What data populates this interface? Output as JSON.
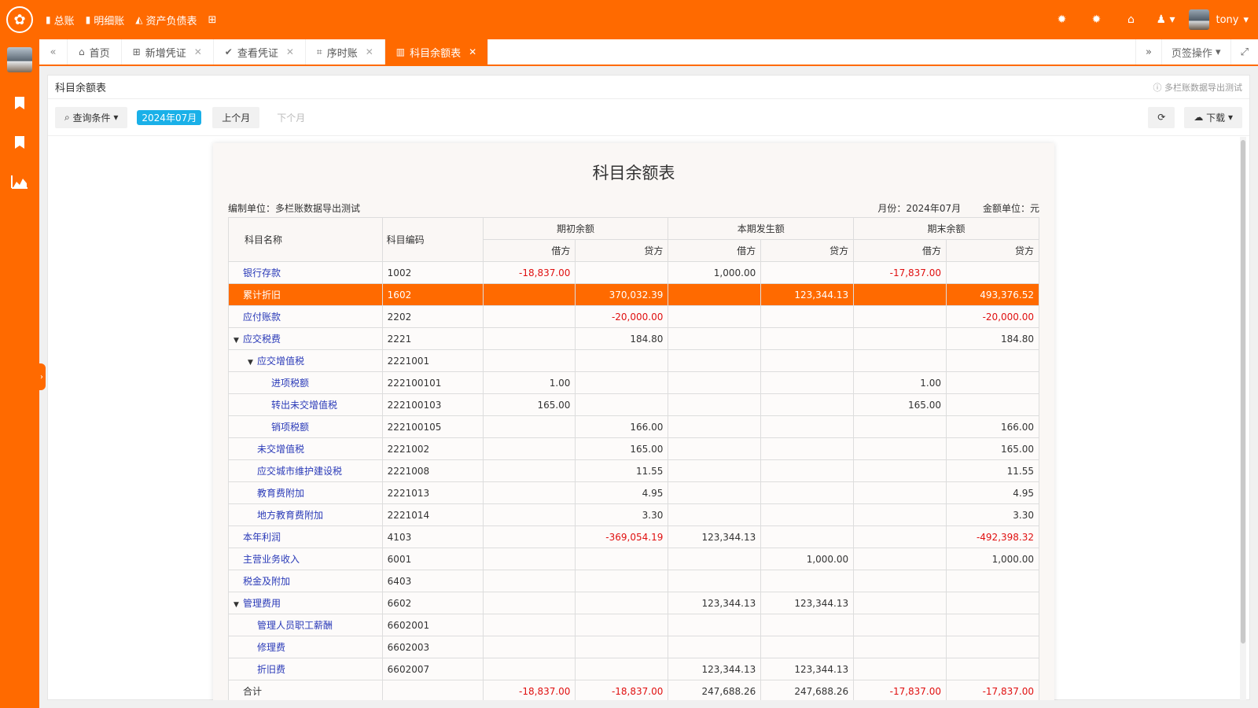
{
  "top_nav": [
    {
      "icon": "bookmark-icon",
      "label": "总账"
    },
    {
      "icon": "bookmark-icon",
      "label": "明细账"
    },
    {
      "icon": "area-chart-icon",
      "label": "资产负债表"
    }
  ],
  "user": {
    "name": "tony"
  },
  "tabs": [
    {
      "label": "首页",
      "icon": "home-icon",
      "closable": false,
      "active": false
    },
    {
      "label": "新增凭证",
      "icon": "plus-square-icon",
      "closable": true,
      "active": false
    },
    {
      "label": "查看凭证",
      "icon": "check-circle-icon",
      "closable": true,
      "active": false
    },
    {
      "label": "序时账",
      "icon": "crop-icon",
      "closable": true,
      "active": false
    },
    {
      "label": "科目余额表",
      "icon": "columns-icon",
      "closable": true,
      "active": true
    }
  ],
  "tab_actions": {
    "label": "页签操作"
  },
  "panel": {
    "title": "科目余额表",
    "tip": "多栏账数据导出测试"
  },
  "toolbar": {
    "query_label": "查询条件",
    "month_badge": "2024年07月",
    "prev_label": "上个月",
    "next_label": "下个月",
    "download_label": "下载"
  },
  "report": {
    "title": "科目余额表",
    "org": "编制单位：多栏账数据导出测试",
    "month": "月份：2024年07月",
    "unit": "金额单位：元",
    "headers": {
      "name": "科目名称",
      "code": "科目编码",
      "opening": "期初余额",
      "period": "本期发生额",
      "closing": "期末余额",
      "debit": "借方",
      "credit": "贷方"
    },
    "rows": [
      {
        "name": "银行存款",
        "code": "1002",
        "level": 0,
        "expand": false,
        "highlight": false,
        "v": [
          "-18,837.00",
          "",
          "1,000.00",
          "",
          "-17,837.00",
          ""
        ]
      },
      {
        "name": "累计折旧",
        "code": "1602",
        "level": 0,
        "expand": false,
        "highlight": true,
        "v": [
          "",
          "370,032.39",
          "",
          "123,344.13",
          "",
          "493,376.52"
        ]
      },
      {
        "name": "应付账款",
        "code": "2202",
        "level": 0,
        "expand": false,
        "highlight": false,
        "v": [
          "",
          "-20,000.00",
          "",
          "",
          "",
          "-20,000.00"
        ]
      },
      {
        "name": "应交税费",
        "code": "2221",
        "level": 0,
        "expand": true,
        "highlight": false,
        "v": [
          "",
          "184.80",
          "",
          "",
          "",
          "184.80"
        ]
      },
      {
        "name": "应交增值税",
        "code": "2221001",
        "level": 1,
        "expand": true,
        "highlight": false,
        "v": [
          "",
          "",
          "",
          "",
          "",
          ""
        ]
      },
      {
        "name": "进项税额",
        "code": "222100101",
        "level": 2,
        "expand": false,
        "highlight": false,
        "v": [
          "1.00",
          "",
          "",
          "",
          "1.00",
          ""
        ]
      },
      {
        "name": "转出未交增值税",
        "code": "222100103",
        "level": 2,
        "expand": false,
        "highlight": false,
        "v": [
          "165.00",
          "",
          "",
          "",
          "165.00",
          ""
        ]
      },
      {
        "name": "销项税额",
        "code": "222100105",
        "level": 2,
        "expand": false,
        "highlight": false,
        "v": [
          "",
          "166.00",
          "",
          "",
          "",
          "166.00"
        ]
      },
      {
        "name": "未交增值税",
        "code": "2221002",
        "level": 1,
        "expand": false,
        "highlight": false,
        "v": [
          "",
          "165.00",
          "",
          "",
          "",
          "165.00"
        ]
      },
      {
        "name": "应交城市维护建设税",
        "code": "2221008",
        "level": 1,
        "expand": false,
        "highlight": false,
        "v": [
          "",
          "11.55",
          "",
          "",
          "",
          "11.55"
        ]
      },
      {
        "name": "教育费附加",
        "code": "2221013",
        "level": 1,
        "expand": false,
        "highlight": false,
        "v": [
          "",
          "4.95",
          "",
          "",
          "",
          "4.95"
        ]
      },
      {
        "name": "地方教育费附加",
        "code": "2221014",
        "level": 1,
        "expand": false,
        "highlight": false,
        "v": [
          "",
          "3.30",
          "",
          "",
          "",
          "3.30"
        ]
      },
      {
        "name": "本年利润",
        "code": "4103",
        "level": 0,
        "expand": false,
        "highlight": false,
        "v": [
          "",
          "-369,054.19",
          "123,344.13",
          "",
          "",
          "-492,398.32"
        ]
      },
      {
        "name": "主营业务收入",
        "code": "6001",
        "level": 0,
        "expand": false,
        "highlight": false,
        "v": [
          "",
          "",
          "",
          "1,000.00",
          "",
          "1,000.00"
        ]
      },
      {
        "name": "税金及附加",
        "code": "6403",
        "level": 0,
        "expand": false,
        "highlight": false,
        "v": [
          "",
          "",
          "",
          "",
          "",
          ""
        ]
      },
      {
        "name": "管理费用",
        "code": "6602",
        "level": 0,
        "expand": true,
        "highlight": false,
        "v": [
          "",
          "",
          "123,344.13",
          "123,344.13",
          "",
          ""
        ]
      },
      {
        "name": "管理人员职工薪酬",
        "code": "6602001",
        "level": 1,
        "expand": false,
        "highlight": false,
        "v": [
          "",
          "",
          "",
          "",
          "",
          ""
        ]
      },
      {
        "name": "修理费",
        "code": "6602003",
        "level": 1,
        "expand": false,
        "highlight": false,
        "v": [
          "",
          "",
          "",
          "",
          "",
          ""
        ]
      },
      {
        "name": "折旧费",
        "code": "6602007",
        "level": 1,
        "expand": false,
        "highlight": false,
        "v": [
          "",
          "",
          "123,344.13",
          "123,344.13",
          "",
          ""
        ]
      },
      {
        "name": "合计",
        "code": "",
        "level": 0,
        "expand": false,
        "highlight": false,
        "total": true,
        "v": [
          "-18,837.00",
          "-18,837.00",
          "247,688.26",
          "247,688.26",
          "-17,837.00",
          "-17,837.00"
        ]
      }
    ]
  },
  "colors": {
    "brand": "#ff6a00",
    "negative": "#e01010",
    "link": "#2a3ab8",
    "badge": "#1ab0e8"
  }
}
